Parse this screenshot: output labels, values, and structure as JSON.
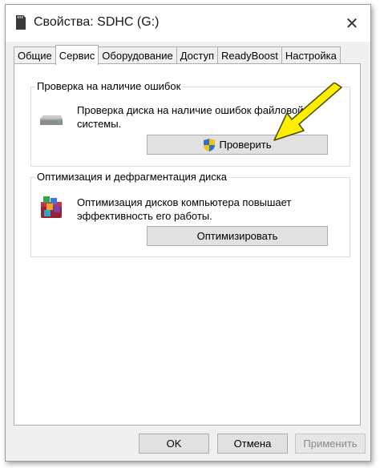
{
  "window": {
    "title": "Свойства: SDHC (G:)",
    "close_glyph": "✕"
  },
  "tabs": [
    {
      "label": "Общие",
      "active": false
    },
    {
      "label": "Сервис",
      "active": true
    },
    {
      "label": "Оборудование",
      "active": false
    },
    {
      "label": "Доступ",
      "active": false
    },
    {
      "label": "ReadyBoost",
      "active": false
    },
    {
      "label": "Настройка",
      "active": false
    }
  ],
  "error_check": {
    "title": "Проверка на наличие ошибок",
    "description": "Проверка диска на наличие ошибок файловой системы.",
    "button_label": "Проверить",
    "icon": "drive-icon"
  },
  "optimize": {
    "title": "Оптимизация и дефрагментация диска",
    "description": "Оптимизация дисков компьютера повышает эффективность его работы.",
    "button_label": "Оптимизировать",
    "icon": "defrag-icon"
  },
  "footer": {
    "ok_label": "OK",
    "cancel_label": "Отмена",
    "apply_label": "Применить",
    "apply_enabled": false
  },
  "colors": {
    "annotation_arrow": "#ffee00",
    "button_face": "#e1e1e1",
    "window_bg": "#f0f0f0"
  }
}
